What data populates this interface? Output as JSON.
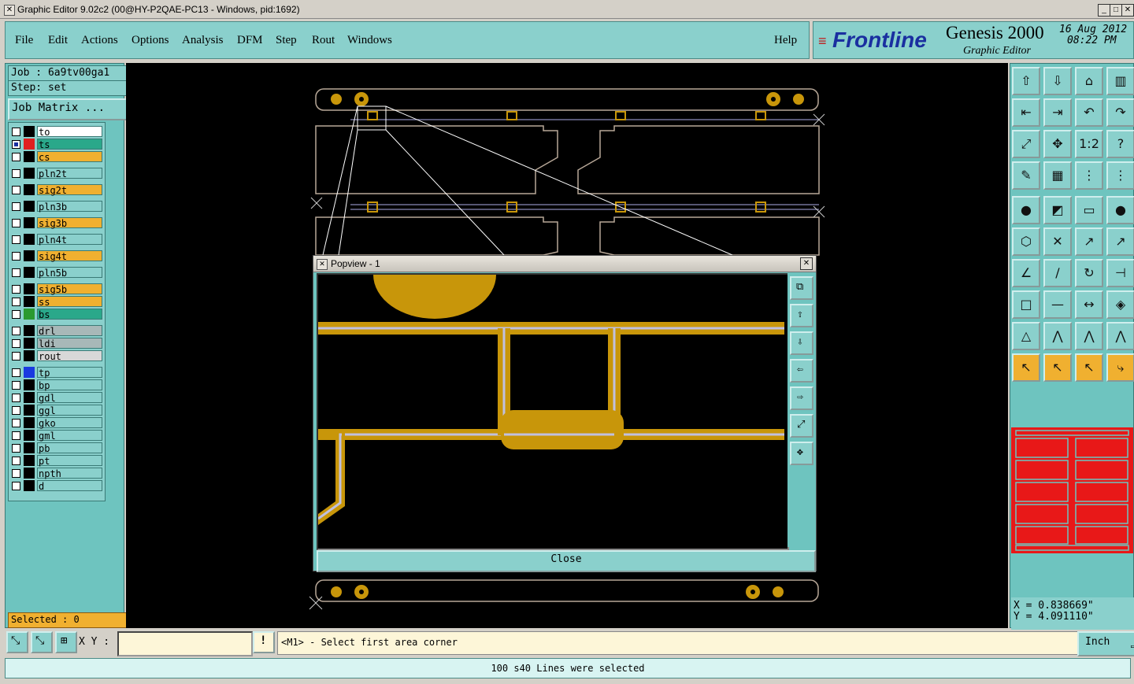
{
  "window": {
    "title": "Graphic Editor 9.02c2 (00@HY-P2QAE-PC13 - Windows, pid:1692)"
  },
  "menu": {
    "file": "File",
    "edit": "Edit",
    "actions": "Actions",
    "options": "Options",
    "analysis": "Analysis",
    "dfm": "DFM",
    "step": "Step",
    "rout": "Rout",
    "windows": "Windows",
    "help": "Help"
  },
  "brand": {
    "logo": "Frontline",
    "product": "Genesis 2000",
    "subtitle": "Graphic Editor",
    "date": "16 Aug 2012",
    "time": "08:22 PM"
  },
  "job": {
    "job_line": "Job : 6a9tv00ga1",
    "step_line": "Step: set",
    "matrix_button": "Job Matrix ..."
  },
  "layers": [
    {
      "name": "to",
      "bg": "#ffffff",
      "swatch": "#000000"
    },
    {
      "name": "ts",
      "bg": "#2aa88a",
      "swatch": "#e02020",
      "checked": true
    },
    {
      "name": "cs",
      "bg": "#f0b030",
      "swatch": "#000000"
    },
    {
      "name": "pln2t",
      "bg": "#8ad0cc",
      "swatch": "#000000"
    },
    {
      "name": "sig2t",
      "bg": "#f0b030",
      "swatch": "#000000"
    },
    {
      "name": "pln3b",
      "bg": "#8ad0cc",
      "swatch": "#000000"
    },
    {
      "name": "sig3b",
      "bg": "#f0b030",
      "swatch": "#000000"
    },
    {
      "name": "pln4t",
      "bg": "#8ad0cc",
      "swatch": "#000000"
    },
    {
      "name": "sig4t",
      "bg": "#f0b030",
      "swatch": "#000000"
    },
    {
      "name": "pln5b",
      "bg": "#8ad0cc",
      "swatch": "#000000"
    },
    {
      "name": "sig5b",
      "bg": "#f0b030",
      "swatch": "#000000"
    },
    {
      "name": "ss",
      "bg": "#f0b030",
      "swatch": "#000000"
    },
    {
      "name": "bs",
      "bg": "#2aa88a",
      "swatch": "#2a9a30"
    },
    {
      "name": "drl",
      "bg": "#a8b8b8",
      "swatch": "#000000"
    },
    {
      "name": "ldi",
      "bg": "#a8b8b8",
      "swatch": "#000000"
    },
    {
      "name": "rout",
      "bg": "#d8d8d8",
      "swatch": "#000000"
    },
    {
      "name": "tp",
      "bg": "#8ad0cc",
      "swatch": "#1a3ae0"
    },
    {
      "name": "bp",
      "bg": "#8ad0cc",
      "swatch": "#000000"
    },
    {
      "name": "gdl",
      "bg": "#8ad0cc",
      "swatch": "#000000"
    },
    {
      "name": "ggl",
      "bg": "#8ad0cc",
      "swatch": "#000000"
    },
    {
      "name": "gko",
      "bg": "#8ad0cc",
      "swatch": "#000000"
    },
    {
      "name": "gml",
      "bg": "#8ad0cc",
      "swatch": "#000000"
    },
    {
      "name": "pb",
      "bg": "#8ad0cc",
      "swatch": "#000000"
    },
    {
      "name": "pt",
      "bg": "#8ad0cc",
      "swatch": "#000000"
    },
    {
      "name": "npth",
      "bg": "#8ad0cc",
      "swatch": "#000000"
    },
    {
      "name": "d",
      "bg": "#8ad0cc",
      "swatch": "#000000"
    }
  ],
  "selected": {
    "label": "Selected : 0"
  },
  "coords": {
    "x": "X = 0.838669\"",
    "y": "Y = 4.091110\""
  },
  "bottom": {
    "xy_label": "X Y :",
    "xy_value": "",
    "prompt": "<M1> - Select first area corner",
    "unit": "Inch"
  },
  "status": {
    "message": "100 s40 Lines were selected"
  },
  "popview": {
    "title": "Popview - 1",
    "close_label": "Close"
  },
  "colors": {
    "panel": "#6ec4bf",
    "panel_light": "#8ad0cc",
    "copper": "#c8960a",
    "outline": "#b8b0d8"
  }
}
